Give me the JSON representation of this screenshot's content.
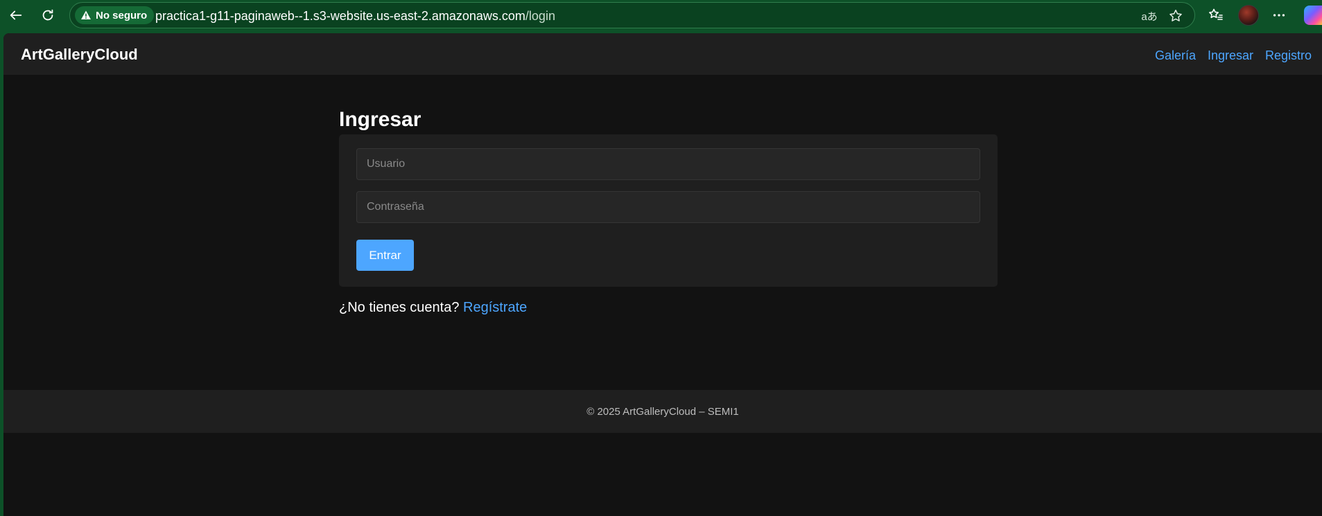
{
  "browser": {
    "security_label": "No seguro",
    "url_host": "practica1-g11-paginaweb--1.s3-website.us-east-2.amazonaws.com",
    "url_path": "/login",
    "translate_glyph": "aあ"
  },
  "site": {
    "brand": "ArtGalleryCloud",
    "nav": {
      "gallery": "Galería",
      "login": "Ingresar",
      "register": "Registro"
    }
  },
  "login": {
    "title": "Ingresar",
    "username_placeholder": "Usuario",
    "username_value": "",
    "password_placeholder": "Contraseña",
    "password_value": "",
    "submit_label": "Entrar",
    "signup_prompt": "¿No tienes cuenta?",
    "signup_link": "Regístrate"
  },
  "footer": {
    "text": "© 2025 ArtGalleryCloud – SEMI1"
  },
  "colors": {
    "browser_accent": "#0d5128",
    "page_bg": "#121212",
    "panel_bg": "#1f1f1f",
    "link": "#4da6ff"
  }
}
